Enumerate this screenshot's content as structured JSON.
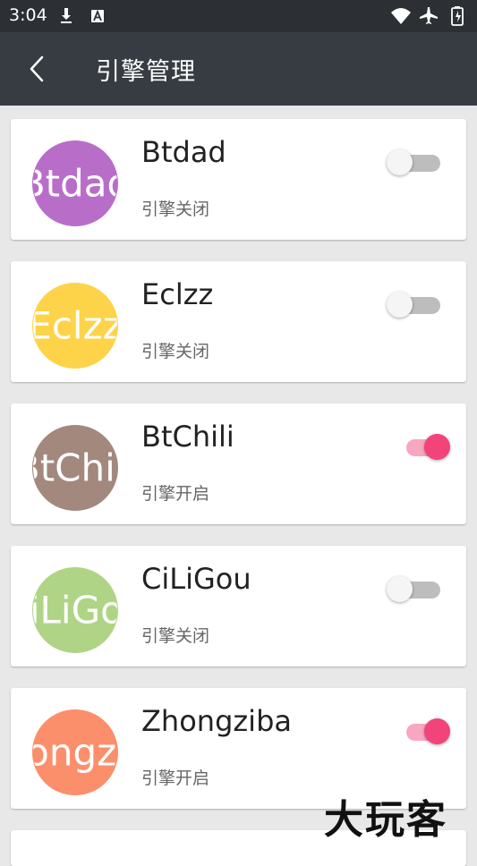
{
  "status_bar": {
    "time": "3:04"
  },
  "app_bar": {
    "title": "引擎管理"
  },
  "engines": [
    {
      "name": "Btdad",
      "avatar_text": "Btdad",
      "avatar_color": "#b86ec9",
      "status": "引擎关闭",
      "enabled": false
    },
    {
      "name": "Eclzz",
      "avatar_text": "Eclzz",
      "avatar_color": "#fdd34a",
      "status": "引擎关闭",
      "enabled": false
    },
    {
      "name": "BtChili",
      "avatar_text": "BtChili",
      "avatar_color": "#a3887e",
      "status": "引擎开启",
      "enabled": true
    },
    {
      "name": "CiLiGou",
      "avatar_text": "CiLiGou",
      "avatar_color": "#b0d486",
      "status": "引擎关闭",
      "enabled": false
    },
    {
      "name": "Zhongziba",
      "avatar_text": "Zhongziba",
      "avatar_color": "#fb8f6b",
      "status": "引擎开启",
      "enabled": true
    }
  ],
  "watermark": "大玩客"
}
